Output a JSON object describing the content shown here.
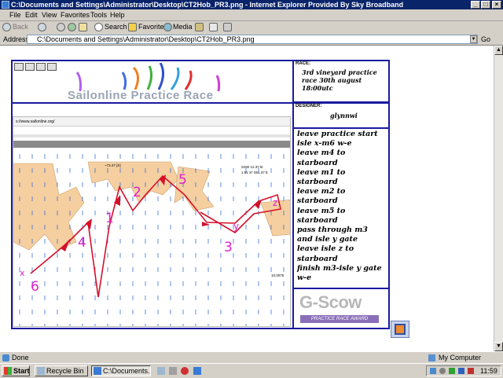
{
  "window": {
    "title": "C:\\Documents and Settings\\Administrator\\Desktop\\CT2Hob_PR3.png - Internet Explorer Provided By Sky Broadband",
    "min_label": "_",
    "max_label": "□",
    "close_label": "×"
  },
  "menu": {
    "items": [
      "File",
      "Edit",
      "View",
      "Favorites",
      "Tools",
      "Help"
    ]
  },
  "toolbar": {
    "back": "Back",
    "search": "Search",
    "favorites": "Favorites",
    "media": "Media"
  },
  "address": {
    "label": "Address",
    "value": "C:\\Documents and Settings\\Administrator\\Desktop\\CT2Hob_PR3.png",
    "go_label": "Go"
  },
  "race": {
    "banner_title": "Sailonline Practice Race",
    "race_label": "RACE:",
    "race_text": "3rd vineyard practice race 30th august 18:00utc",
    "designer_label": "DESIGNER:",
    "designer_text": "glynnwi",
    "course": [
      "leave practice start",
      "isle x-m6 w-e",
      "leave m4 to starboard",
      "leave m1 to starboard",
      "leave m2 to starboard",
      "leave m5 to starboard",
      "pass through m3 and isle y gate",
      "leave isle z to starboard",
      "finish m3-isle y gate w-e"
    ],
    "logo_text": "G-Scow",
    "logo_sub": "PRACTICE RACE AWARD"
  },
  "map": {
    "url_text": "s://www.sailonline.org/",
    "mark_labels": [
      "1",
      "2",
      "3",
      "4",
      "5",
      "6",
      "x",
      "y",
      "z"
    ],
    "coord_top": "~73.47 [S]",
    "coord_right_1": "SSW 12.37 kt",
    "coord_right_2": "1.51 S* 051.37 E",
    "coord_bottom": "10.0075"
  },
  "status": {
    "done": "Done",
    "zone": "My Computer"
  },
  "taskbar": {
    "start": "Start",
    "items": [
      "Recycle Bin",
      "C:\\Documents..."
    ],
    "clock": "11:59"
  },
  "colors": {
    "frame_blue": "#1a1aa0",
    "land": "#f5cfa0",
    "route": "#d4102a",
    "marks": "#e020c8",
    "wind_arrows": "#3b6fd6"
  }
}
